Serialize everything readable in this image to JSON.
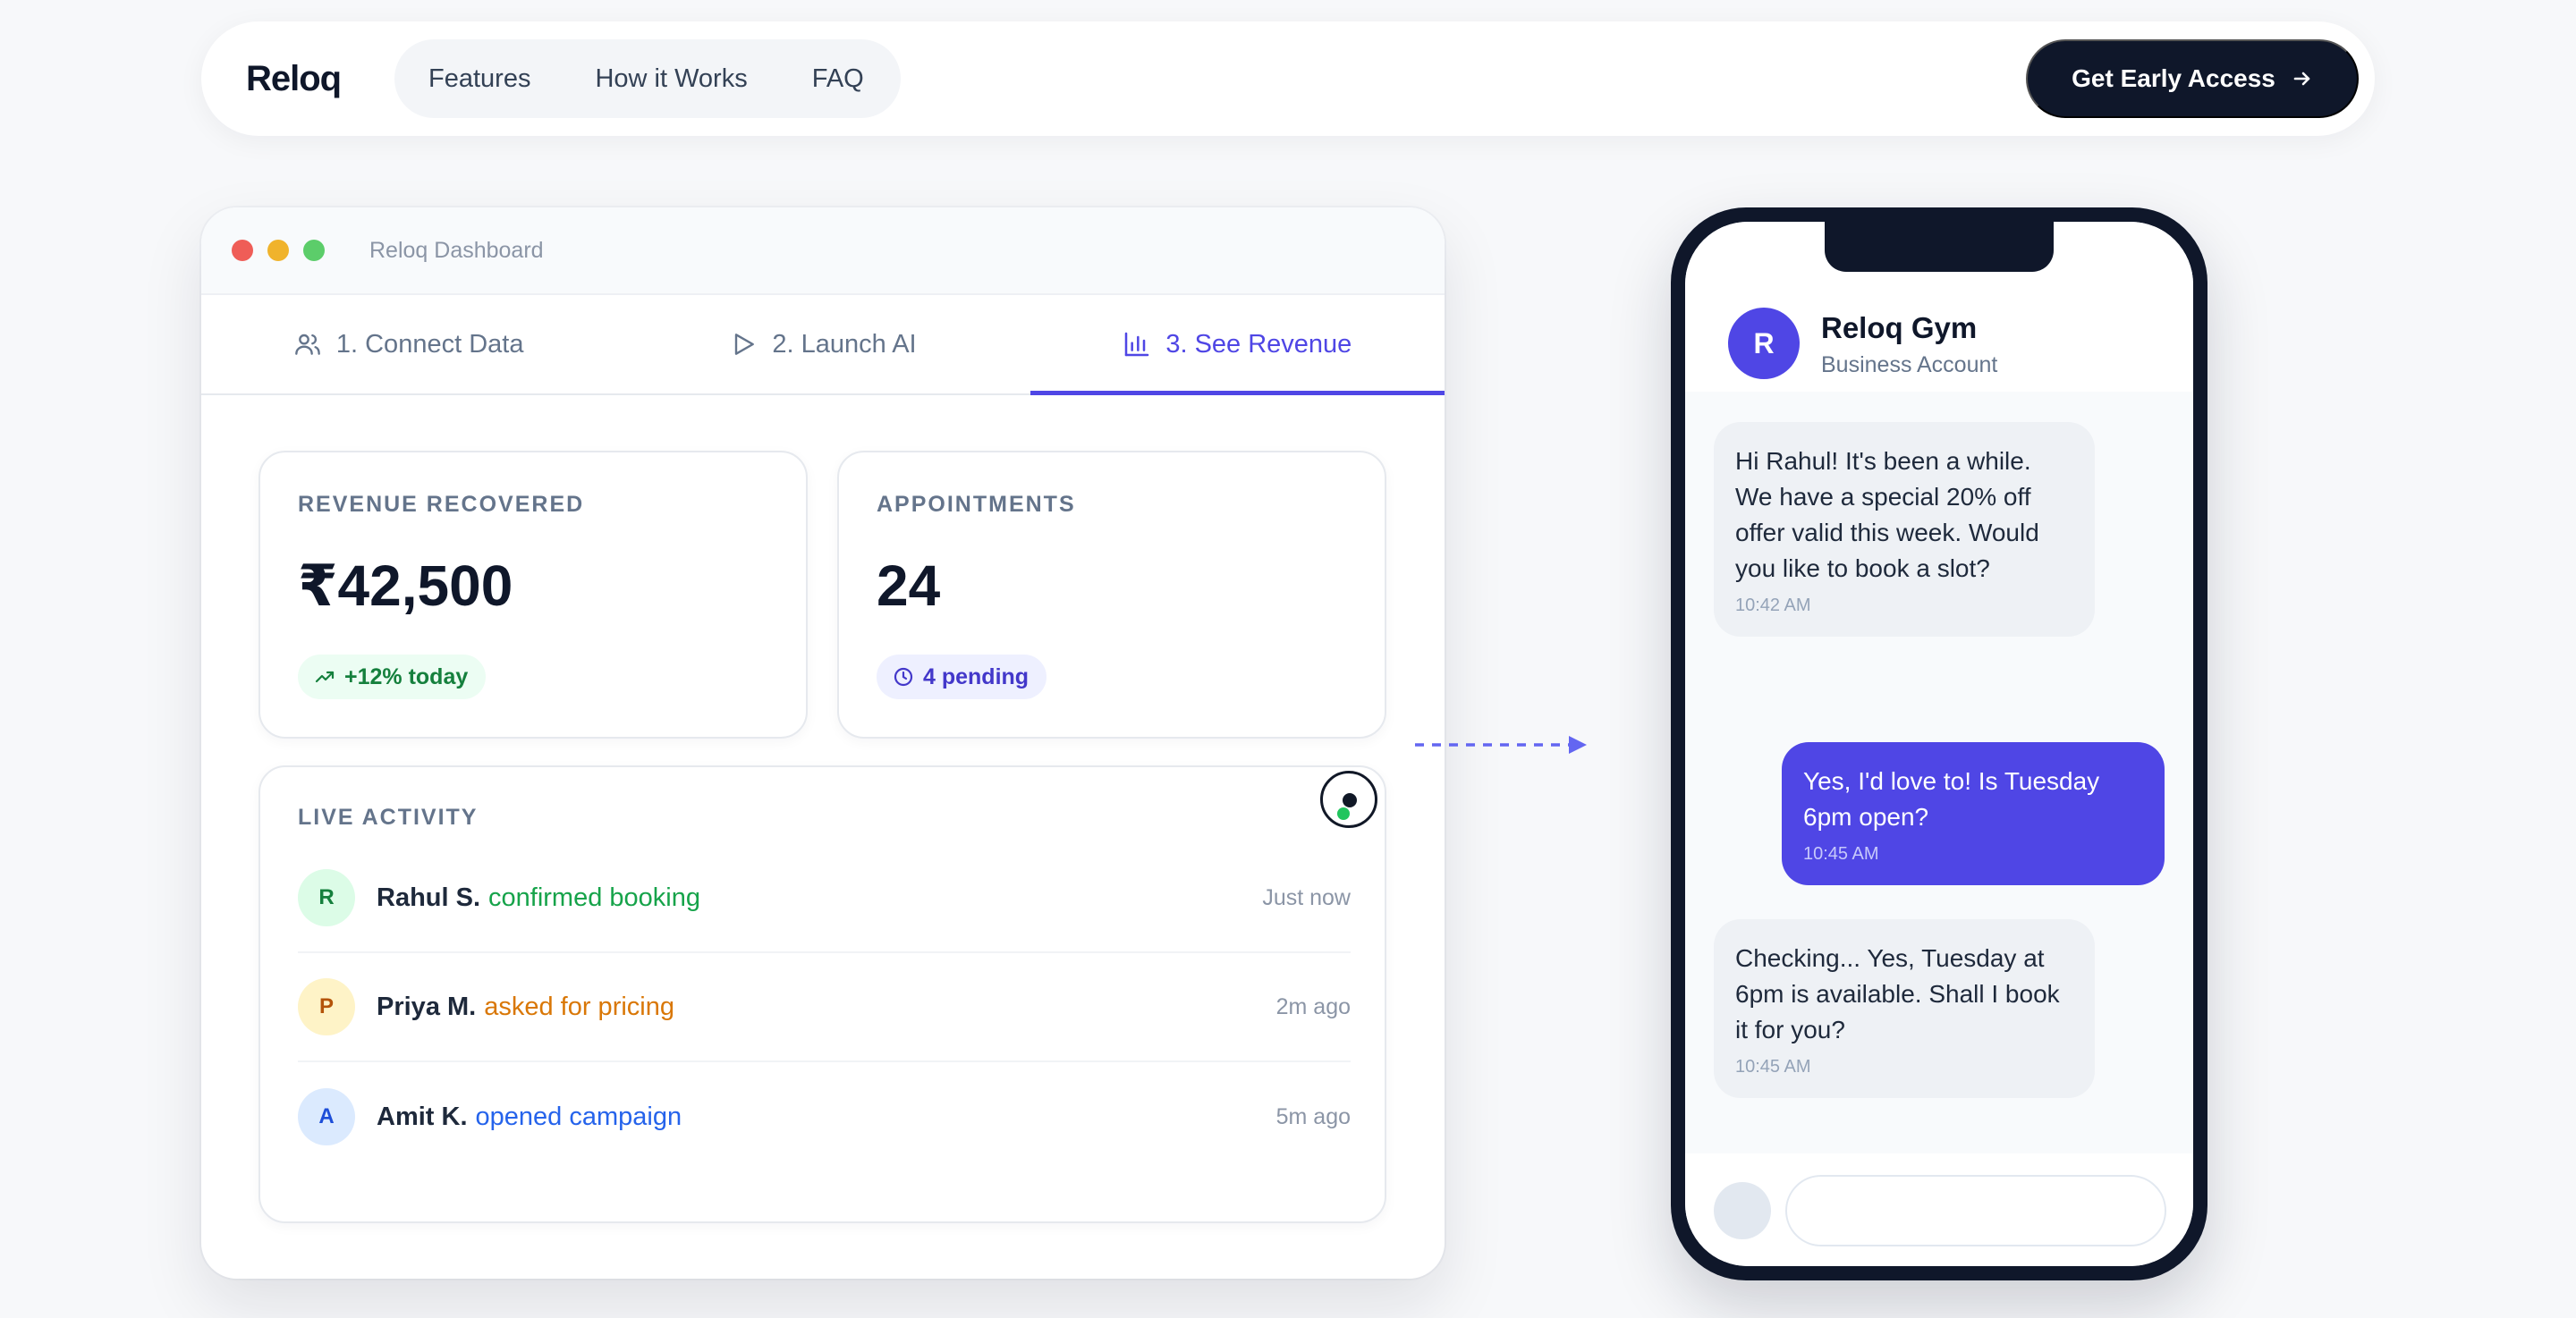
{
  "nav": {
    "logo": "Reloq",
    "links": [
      "Features",
      "How it Works",
      "FAQ"
    ],
    "cta_label": "Get Early Access",
    "cta_icon": "arrow-right-icon"
  },
  "dashboard": {
    "window_title": "Reloq Dashboard",
    "tabs": [
      {
        "label": "1. Connect Data",
        "icon": "users-icon",
        "active": false
      },
      {
        "label": "2. Launch AI",
        "icon": "play-icon",
        "active": false
      },
      {
        "label": "3. See Revenue",
        "icon": "bar-chart-icon",
        "active": true
      }
    ],
    "stats": [
      {
        "label": "REVENUE RECOVERED",
        "value": "₹42,500",
        "chip": "+12% today",
        "chip_icon": "trending-up-icon",
        "chip_color": "#15803d"
      },
      {
        "label": "APPOINTMENTS",
        "value": "24",
        "chip": "4 pending",
        "chip_icon": "clock-icon",
        "chip_color": "#4338ca"
      }
    ],
    "activity": {
      "title": "LIVE ACTIVITY",
      "items": [
        {
          "initial": "R",
          "name": "Rahul S.",
          "action": "confirmed booking",
          "time": "Just now",
          "color": "#16a34a"
        },
        {
          "initial": "P",
          "name": "Priya M.",
          "action": "asked for pricing",
          "time": "2m ago",
          "color": "#d97706"
        },
        {
          "initial": "A",
          "name": "Amit K.",
          "action": "opened campaign",
          "time": "5m ago",
          "color": "#2563eb"
        }
      ]
    }
  },
  "phone": {
    "contact_initial": "R",
    "contact_name": "Reloq Gym",
    "contact_sub": "Business Account",
    "messages": [
      {
        "from": "business",
        "text": "Hi Rahul! It's been a while. We have a special 20% off offer valid this week. Would you like to book a slot?",
        "time": "10:42 AM"
      },
      {
        "from": "customer",
        "text": "Yes, I'd love to! Is Tuesday 6pm open?",
        "time": "10:45 AM"
      },
      {
        "from": "business",
        "text": "Checking... Yes, Tuesday at 6pm is available. Shall I book it for you?",
        "time": "10:45 AM"
      }
    ]
  },
  "colors": {
    "accent": "#4f46e5",
    "dark": "#0f172a",
    "background": "#f7f8fa"
  }
}
